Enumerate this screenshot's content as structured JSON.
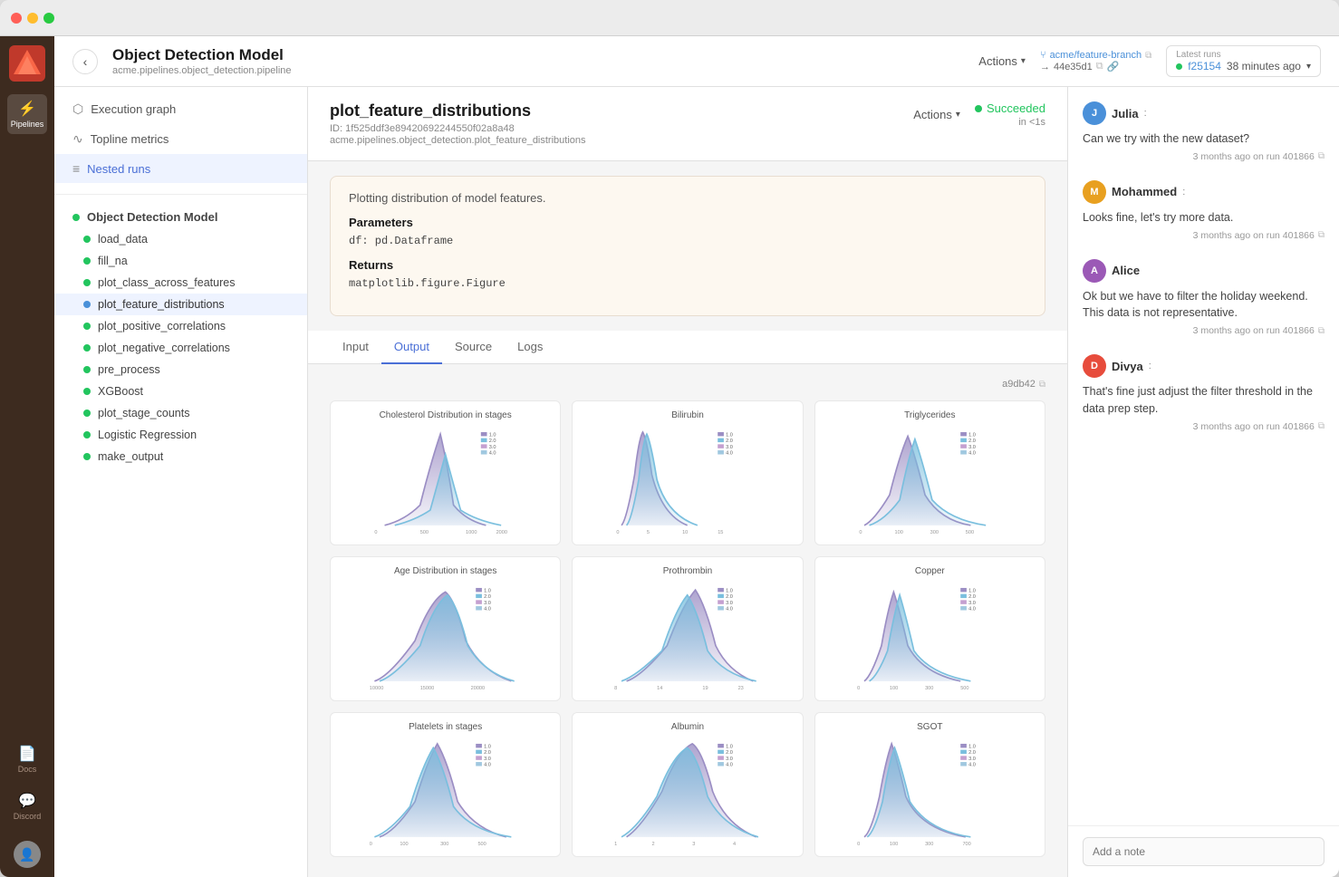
{
  "window": {
    "title": "Object Detection Model"
  },
  "nav": {
    "items": [
      {
        "id": "pipelines",
        "label": "Pipelines",
        "icon": "⚡",
        "active": true
      },
      {
        "id": "docs",
        "label": "Docs",
        "icon": "📄"
      },
      {
        "id": "discord",
        "label": "Discord",
        "icon": "💬"
      }
    ]
  },
  "header": {
    "back_label": "‹",
    "title": "Object Detection Model",
    "subtitle": "acme.pipelines.object_detection.pipeline",
    "actions_label": "Actions",
    "branch": "acme/feature-branch",
    "commit": "44e35d1",
    "latest_runs_label": "Latest runs",
    "run_id": "f25154",
    "run_time": "38 minutes ago"
  },
  "left_panel": {
    "menu_items": [
      {
        "id": "execution-graph",
        "label": "Execution graph",
        "icon": "⬡"
      },
      {
        "id": "topline-metrics",
        "label": "Topline metrics",
        "icon": "∿"
      },
      {
        "id": "nested-runs",
        "label": "Nested runs",
        "icon": "≡",
        "active": true
      }
    ],
    "tree": {
      "root": "Object Detection Model",
      "items": [
        {
          "id": "load_data",
          "label": "load_data",
          "color": "green"
        },
        {
          "id": "fill_na",
          "label": "fill_na",
          "color": "green"
        },
        {
          "id": "plot_class_across_features",
          "label": "plot_class_across_features",
          "color": "green"
        },
        {
          "id": "plot_feature_distributions",
          "label": "plot_feature_distributions",
          "color": "blue",
          "active": true
        },
        {
          "id": "plot_positive_correlations",
          "label": "plot_positive_correlations",
          "color": "green"
        },
        {
          "id": "plot_negative_correlations",
          "label": "plot_negative_correlations",
          "color": "green"
        },
        {
          "id": "pre_process",
          "label": "pre_process",
          "color": "green"
        },
        {
          "id": "XGBoost",
          "label": "XGBoost",
          "color": "green"
        },
        {
          "id": "plot_stage_counts",
          "label": "plot_stage_counts",
          "color": "green"
        },
        {
          "id": "Logistic_Regression",
          "label": "Logistic Regression",
          "color": "green"
        },
        {
          "id": "make_output",
          "label": "make_output",
          "color": "green"
        }
      ]
    }
  },
  "step": {
    "title": "plot_feature_distributions",
    "id": "ID: 1f525ddf3e89420692244550f02a8a48",
    "path": "acme.pipelines.object_detection.plot_feature_distributions",
    "actions_label": "Actions",
    "status": "Succeeded",
    "status_time": "in <1s",
    "doc": {
      "description": "Plotting distribution of model features.",
      "parameters_label": "Parameters",
      "params": "df: pd.Dataframe",
      "returns_label": "Returns",
      "returns": "matplotlib.figure.Figure"
    },
    "tabs": [
      {
        "id": "input",
        "label": "Input"
      },
      {
        "id": "output",
        "label": "Output",
        "active": true
      },
      {
        "id": "source",
        "label": "Source"
      },
      {
        "id": "logs",
        "label": "Logs"
      }
    ],
    "output_hash": "a9db42",
    "charts": [
      {
        "id": "cholesterol",
        "title": "Cholesterol Distribution in stages"
      },
      {
        "id": "bilirubin",
        "title": "Bilirubin"
      },
      {
        "id": "triglycerides",
        "title": "Triglycerides"
      },
      {
        "id": "age",
        "title": "Age Distribution in stages"
      },
      {
        "id": "prothrombin",
        "title": "Prothrombin"
      },
      {
        "id": "copper",
        "title": "Copper"
      },
      {
        "id": "platelets",
        "title": "Platelets in stages"
      },
      {
        "id": "albumin",
        "title": "Albumin"
      },
      {
        "id": "sgot",
        "title": "SGOT"
      }
    ]
  },
  "comments": {
    "items": [
      {
        "id": "julia",
        "author": "Julia",
        "avatar_initials": "J",
        "avatar_class": "avatar-julia",
        "text": "Can we try with the new dataset?",
        "meta": "3 months ago on run 401866"
      },
      {
        "id": "mohammed",
        "author": "Mohammed",
        "avatar_initials": "M",
        "avatar_class": "avatar-mohammed",
        "text": "Looks fine, let's try more data.",
        "meta": "3 months ago on run 401866"
      },
      {
        "id": "alice",
        "author": "Alice",
        "avatar_initials": "A",
        "avatar_class": "avatar-alice",
        "text": "Ok but we have to filter the holiday weekend. This data is not representative.",
        "meta": "3 months ago on run 401866"
      },
      {
        "id": "divya",
        "author": "Divya",
        "avatar_initials": "D",
        "avatar_class": "avatar-divya",
        "text": "That's fine just adjust the filter threshold in the data prep step.",
        "meta": "3 months ago on run 401866"
      }
    ],
    "add_note_placeholder": "Add a note"
  }
}
